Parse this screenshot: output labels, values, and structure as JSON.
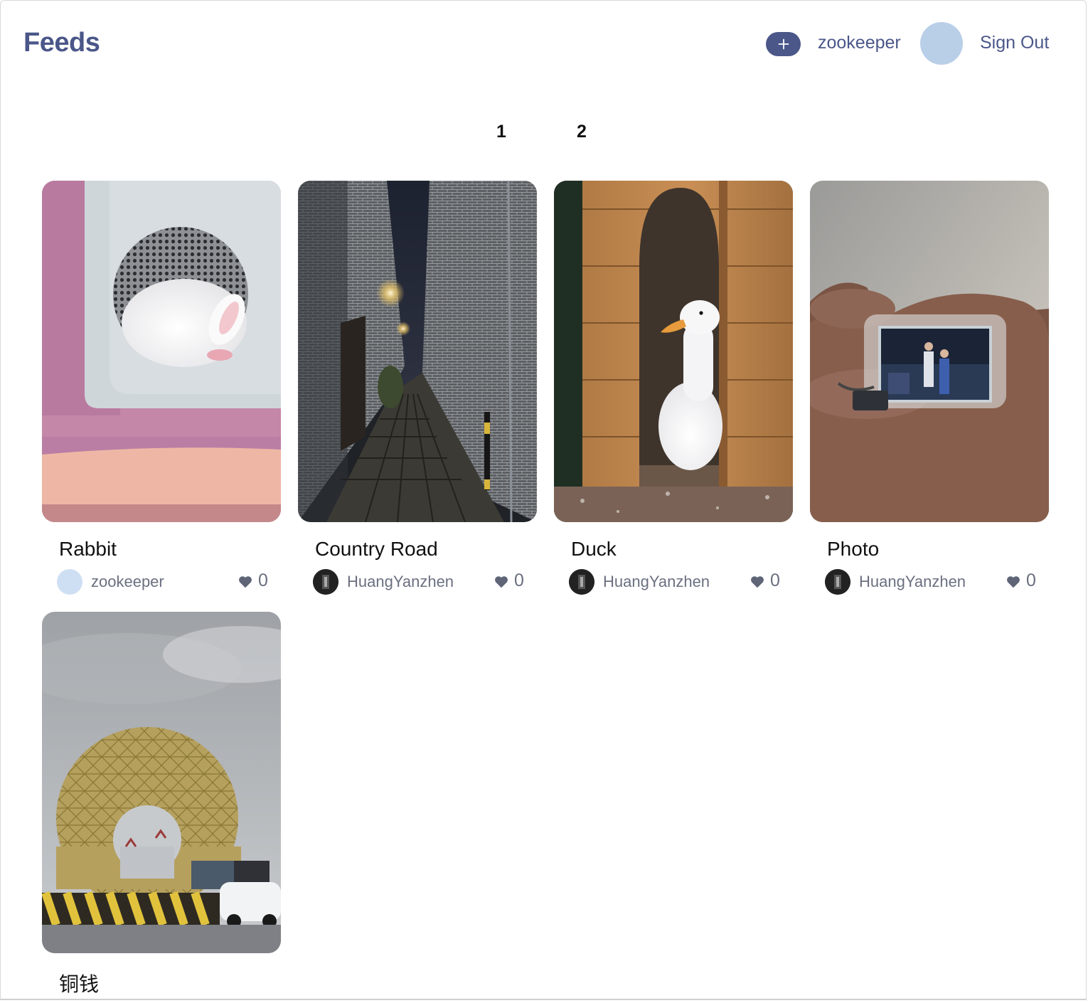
{
  "header": {
    "title": "Feeds",
    "add_icon": "plus-icon",
    "username": "zookeeper",
    "sign_out": "Sign Out"
  },
  "pagination": {
    "pages": [
      "1",
      "2"
    ]
  },
  "posts": [
    {
      "title": "Rabbit",
      "author": "zookeeper",
      "likes": "0",
      "image": "rabbit-in-cage"
    },
    {
      "title": "Country Road",
      "author": "HuangYanzhen",
      "likes": "0",
      "image": "night-alley"
    },
    {
      "title": "Duck",
      "author": "HuangYanzhen",
      "likes": "0",
      "image": "duck-in-wooden-house"
    },
    {
      "title": "Photo",
      "author": "HuangYanzhen",
      "likes": "0",
      "image": "keychain-photo-in-hand"
    },
    {
      "title": "铜钱",
      "author": "",
      "likes": "",
      "image": "round-golden-building"
    }
  ],
  "colors": {
    "brand": "#4b5789",
    "avatar_light": "#b9cfe8",
    "meta_text": "#6b7080"
  }
}
